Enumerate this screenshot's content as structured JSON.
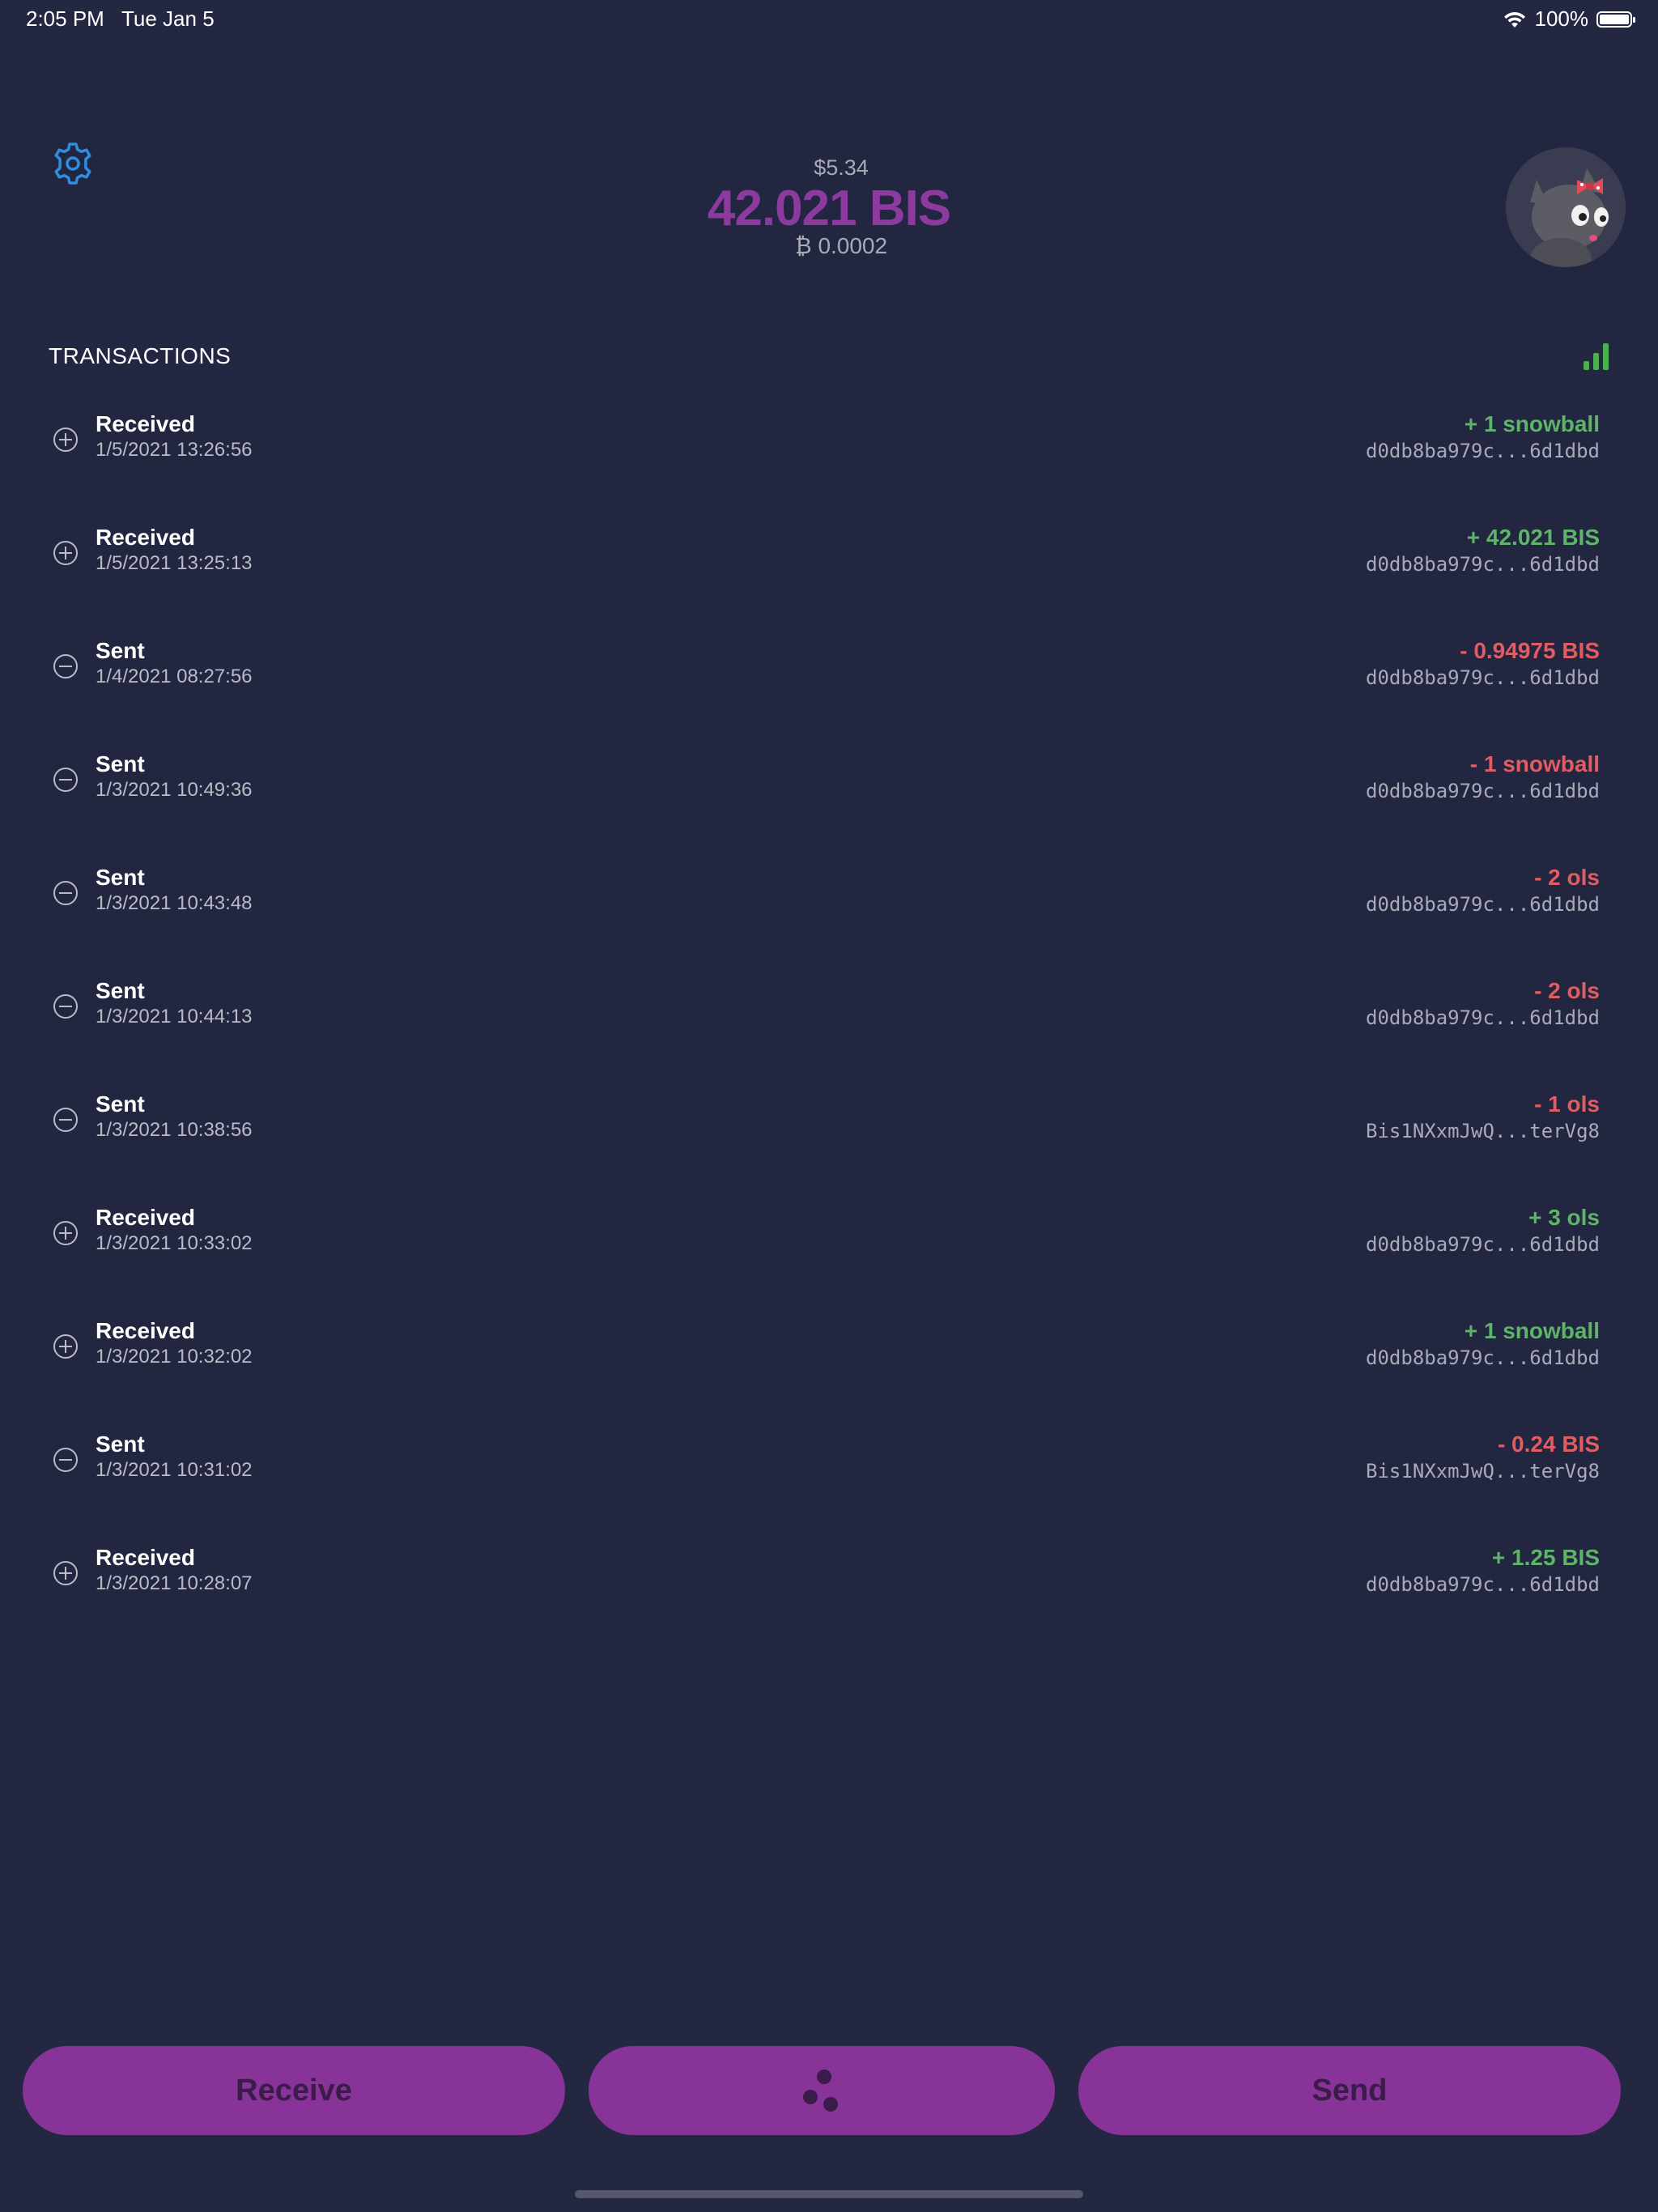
{
  "status_bar": {
    "time": "2:05 PM",
    "date": "Tue Jan 5",
    "battery": "100%"
  },
  "balance": {
    "fiat": "$5.34",
    "main": "42.021 BIS",
    "btc_symbol": "₿",
    "btc": "0.0002"
  },
  "transactions": {
    "title": "TRANSACTIONS",
    "items": [
      {
        "type": "Received",
        "date": "1/5/2021 13:26:56",
        "amount": "+ 1 snowball",
        "address": "d0db8ba979c...6d1dbd",
        "direction": "in"
      },
      {
        "type": "Received",
        "date": "1/5/2021 13:25:13",
        "amount": "+ 42.021 BIS",
        "address": "d0db8ba979c...6d1dbd",
        "direction": "in"
      },
      {
        "type": "Sent",
        "date": "1/4/2021 08:27:56",
        "amount": "- 0.94975 BIS",
        "address": "d0db8ba979c...6d1dbd",
        "direction": "out"
      },
      {
        "type": "Sent",
        "date": "1/3/2021 10:49:36",
        "amount": "- 1 snowball",
        "address": "d0db8ba979c...6d1dbd",
        "direction": "out"
      },
      {
        "type": "Sent",
        "date": "1/3/2021 10:43:48",
        "amount": "- 2 ols",
        "address": "d0db8ba979c...6d1dbd",
        "direction": "out"
      },
      {
        "type": "Sent",
        "date": "1/3/2021 10:44:13",
        "amount": "- 2 ols",
        "address": "d0db8ba979c...6d1dbd",
        "direction": "out"
      },
      {
        "type": "Sent",
        "date": "1/3/2021 10:38:56",
        "amount": "- 1 ols",
        "address": "Bis1NXxmJwQ...terVg8",
        "direction": "out"
      },
      {
        "type": "Received",
        "date": "1/3/2021 10:33:02",
        "amount": "+ 3 ols",
        "address": "d0db8ba979c...6d1dbd",
        "direction": "in"
      },
      {
        "type": "Received",
        "date": "1/3/2021 10:32:02",
        "amount": "+ 1 snowball",
        "address": "d0db8ba979c...6d1dbd",
        "direction": "in"
      },
      {
        "type": "Sent",
        "date": "1/3/2021 10:31:02",
        "amount": "- 0.24 BIS",
        "address": "Bis1NXxmJwQ...terVg8",
        "direction": "out"
      },
      {
        "type": "Received",
        "date": "1/3/2021 10:28:07",
        "amount": "+ 1.25 BIS",
        "address": "d0db8ba979c...6d1dbd",
        "direction": "in"
      }
    ]
  },
  "actions": {
    "receive_label": "Receive",
    "send_label": "Send"
  },
  "icons": {
    "settings": "gear-icon",
    "chart": "signal-bars-icon",
    "share": "share-dots-icon",
    "received": "plus-circle-icon",
    "sent": "minus-circle-icon"
  },
  "colors": {
    "background": "#232742",
    "card": "#222640",
    "accent": "#883398",
    "balance": "#8d3a9e",
    "settings_icon": "#2e8ee0",
    "positive": "#5fb36a",
    "negative": "#e05d62"
  }
}
